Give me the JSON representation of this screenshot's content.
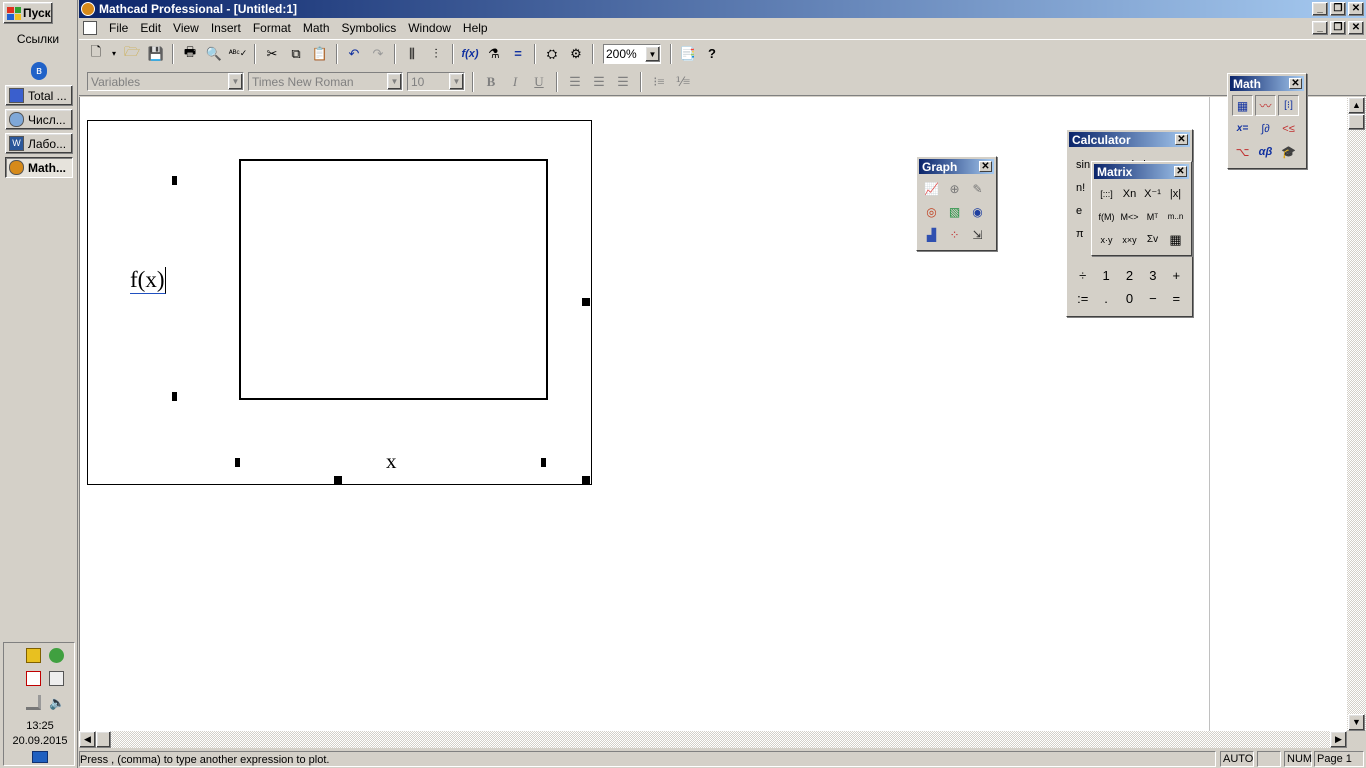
{
  "taskbar": {
    "start_label": "Пуск",
    "links_label": "Ссылки",
    "tasks": [
      {
        "label": "Total ...",
        "active": false
      },
      {
        "label": "Числ...",
        "active": false
      },
      {
        "label": "Лабо...",
        "active": false
      },
      {
        "label": "Math...",
        "active": true
      }
    ],
    "time": "13:25",
    "date": "20.09.2015"
  },
  "window": {
    "title": "Mathcad Professional - [Untitled:1]",
    "controls": [
      "_",
      "❐",
      "✕"
    ]
  },
  "menu": [
    "File",
    "Edit",
    "View",
    "Insert",
    "Format",
    "Math",
    "Symbolics",
    "Window",
    "Help"
  ],
  "toolbar": {
    "zoom": "200%"
  },
  "format_bar": {
    "style": "Variables",
    "font": "Times New Roman",
    "size": "10",
    "bold": "B",
    "italic": "I",
    "underline": "U"
  },
  "plot": {
    "y_placeholder": "f(x)",
    "x_placeholder": "x"
  },
  "palettes": {
    "math_title": "Math",
    "graph_title": "Graph",
    "calculator_title": "Calculator",
    "matrix_title": "Matrix",
    "calc_partial_keys": [
      "sin",
      "cos",
      "tan",
      "ln",
      "log",
      "n!",
      "e",
      "π"
    ],
    "calc_keys": [
      "÷",
      "1",
      "2",
      "3",
      "+",
      ":=",
      ".",
      "0",
      "−",
      "="
    ],
    "matrix_keys": [
      "[:::]",
      "Xn",
      "X⁻¹",
      "|x|",
      "f(M)",
      "M<>",
      "Mᵀ",
      "m..n",
      "x·y",
      "x×y",
      "Σv",
      "▦"
    ]
  },
  "status": {
    "message": "Press , (comma) to type another expression to plot.",
    "mode": "AUTO",
    "num": "NUM",
    "page": "Page 1"
  }
}
